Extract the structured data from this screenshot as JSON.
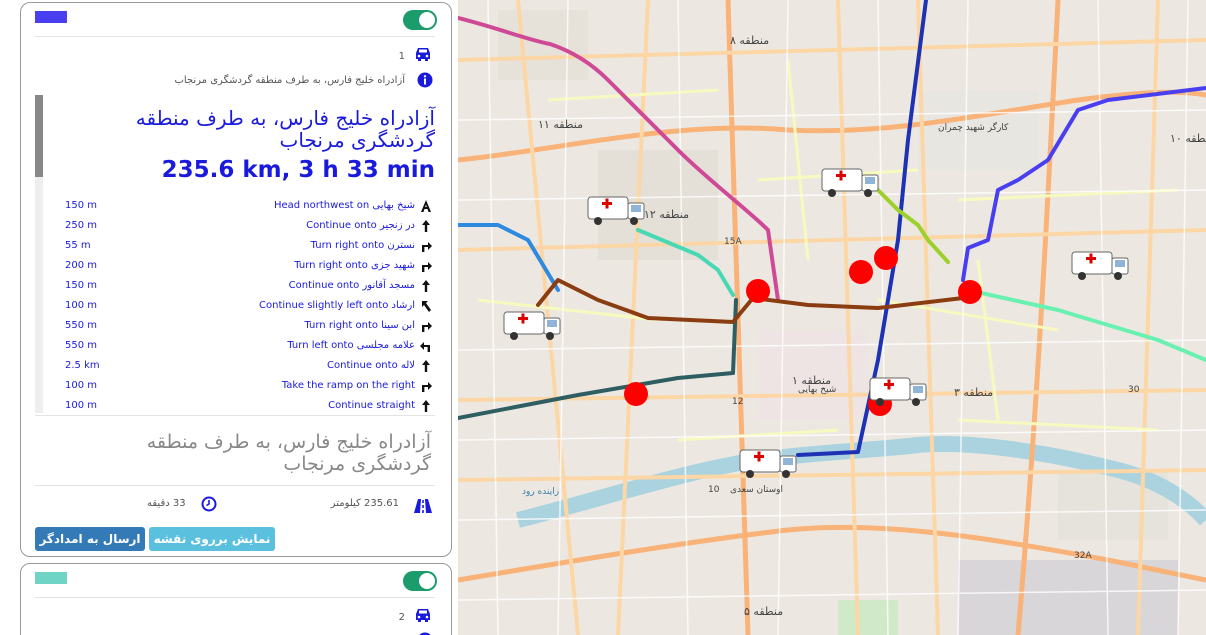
{
  "routes": [
    {
      "swatch_color": "#4a3ff0",
      "number": "1",
      "info_text": "آزادراه خلیج فارس، به طرف منطقه گردشگری مرنجاب",
      "title": "آزادراه خلیج فارس، به طرف منطقه گردشگری مرنجاب",
      "summary": "235.6 km, 3 h 33 min",
      "steps": [
        {
          "instruction": "Head northwest on شیخ بهایی",
          "distance": "150 m",
          "icon": "depart-icon"
        },
        {
          "instruction": "Continue onto در زنجیر",
          "distance": "250 m",
          "icon": "straight-arrow-icon"
        },
        {
          "instruction": "Turn right onto نسترن",
          "distance": "55 m",
          "icon": "turn-right-arrow-icon"
        },
        {
          "instruction": "Turn right onto شهید جزی",
          "distance": "200 m",
          "icon": "turn-right-arrow-icon"
        },
        {
          "instruction": "Continue onto مسجد آقانور",
          "distance": "150 m",
          "icon": "straight-arrow-icon"
        },
        {
          "instruction": "Continue slightly left onto ارشاد",
          "distance": "100 m",
          "icon": "slight-left-arrow-icon"
        },
        {
          "instruction": "Turn right onto ابن سینا",
          "distance": "550 m",
          "icon": "turn-right-arrow-icon"
        },
        {
          "instruction": "Turn left onto علامه مجلسی",
          "distance": "550 m",
          "icon": "turn-left-arrow-icon"
        },
        {
          "instruction": "Continue onto لاله",
          "distance": "2.5 km",
          "icon": "straight-arrow-icon"
        },
        {
          "instruction": "Take the ramp on the right",
          "distance": "100 m",
          "icon": "turn-right-arrow-icon"
        },
        {
          "instruction": "Continue straight",
          "distance": "100 m",
          "icon": "straight-arrow-icon"
        }
      ],
      "title_secondary": "آزادراه خلیج فارس، به طرف منطقه گردشگری مرنجاب",
      "distance_text": "235.61 کیلومتر",
      "duration_text": "33 دقیقه",
      "show_on_map_label": "نمایش برروی نقشه",
      "send_to_rescuer_label": "ارسال به امدادگر"
    },
    {
      "swatch_color": "#6fd3c6",
      "number": "2"
    }
  ],
  "colors": {
    "primary_blue": "#1a1adc",
    "toggle_on": "#1b9c6d",
    "btn_info": "#5bc0de",
    "btn_primary": "#337ab7",
    "marker_red": "#ff0000"
  },
  "map": {
    "labels": [
      "منطقه ۸",
      "منطقه ۱۱",
      "منطقه ۱۲",
      "منطقه ۱",
      "منطقه ۳",
      "منطقه ۵",
      "منطقه ۱۰",
      "15A",
      "12",
      "10",
      "30",
      "32A",
      "زاینده رود",
      "اوستان سعدی",
      "کارگر شهید چمران",
      "شیخ بهایی"
    ]
  }
}
